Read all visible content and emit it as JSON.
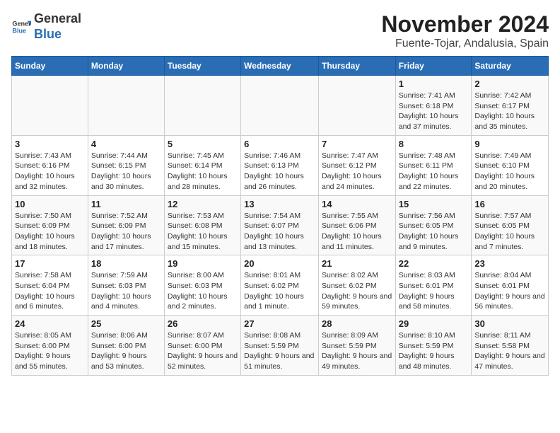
{
  "logo": {
    "general": "General",
    "blue": "Blue"
  },
  "title": "November 2024",
  "subtitle": "Fuente-Tojar, Andalusia, Spain",
  "weekdays": [
    "Sunday",
    "Monday",
    "Tuesday",
    "Wednesday",
    "Thursday",
    "Friday",
    "Saturday"
  ],
  "weeks": [
    [
      {
        "day": "",
        "details": ""
      },
      {
        "day": "",
        "details": ""
      },
      {
        "day": "",
        "details": ""
      },
      {
        "day": "",
        "details": ""
      },
      {
        "day": "",
        "details": ""
      },
      {
        "day": "1",
        "details": "Sunrise: 7:41 AM\nSunset: 6:18 PM\nDaylight: 10 hours and 37 minutes."
      },
      {
        "day": "2",
        "details": "Sunrise: 7:42 AM\nSunset: 6:17 PM\nDaylight: 10 hours and 35 minutes."
      }
    ],
    [
      {
        "day": "3",
        "details": "Sunrise: 7:43 AM\nSunset: 6:16 PM\nDaylight: 10 hours and 32 minutes."
      },
      {
        "day": "4",
        "details": "Sunrise: 7:44 AM\nSunset: 6:15 PM\nDaylight: 10 hours and 30 minutes."
      },
      {
        "day": "5",
        "details": "Sunrise: 7:45 AM\nSunset: 6:14 PM\nDaylight: 10 hours and 28 minutes."
      },
      {
        "day": "6",
        "details": "Sunrise: 7:46 AM\nSunset: 6:13 PM\nDaylight: 10 hours and 26 minutes."
      },
      {
        "day": "7",
        "details": "Sunrise: 7:47 AM\nSunset: 6:12 PM\nDaylight: 10 hours and 24 minutes."
      },
      {
        "day": "8",
        "details": "Sunrise: 7:48 AM\nSunset: 6:11 PM\nDaylight: 10 hours and 22 minutes."
      },
      {
        "day": "9",
        "details": "Sunrise: 7:49 AM\nSunset: 6:10 PM\nDaylight: 10 hours and 20 minutes."
      }
    ],
    [
      {
        "day": "10",
        "details": "Sunrise: 7:50 AM\nSunset: 6:09 PM\nDaylight: 10 hours and 18 minutes."
      },
      {
        "day": "11",
        "details": "Sunrise: 7:52 AM\nSunset: 6:09 PM\nDaylight: 10 hours and 17 minutes."
      },
      {
        "day": "12",
        "details": "Sunrise: 7:53 AM\nSunset: 6:08 PM\nDaylight: 10 hours and 15 minutes."
      },
      {
        "day": "13",
        "details": "Sunrise: 7:54 AM\nSunset: 6:07 PM\nDaylight: 10 hours and 13 minutes."
      },
      {
        "day": "14",
        "details": "Sunrise: 7:55 AM\nSunset: 6:06 PM\nDaylight: 10 hours and 11 minutes."
      },
      {
        "day": "15",
        "details": "Sunrise: 7:56 AM\nSunset: 6:05 PM\nDaylight: 10 hours and 9 minutes."
      },
      {
        "day": "16",
        "details": "Sunrise: 7:57 AM\nSunset: 6:05 PM\nDaylight: 10 hours and 7 minutes."
      }
    ],
    [
      {
        "day": "17",
        "details": "Sunrise: 7:58 AM\nSunset: 6:04 PM\nDaylight: 10 hours and 6 minutes."
      },
      {
        "day": "18",
        "details": "Sunrise: 7:59 AM\nSunset: 6:03 PM\nDaylight: 10 hours and 4 minutes."
      },
      {
        "day": "19",
        "details": "Sunrise: 8:00 AM\nSunset: 6:03 PM\nDaylight: 10 hours and 2 minutes."
      },
      {
        "day": "20",
        "details": "Sunrise: 8:01 AM\nSunset: 6:02 PM\nDaylight: 10 hours and 1 minute."
      },
      {
        "day": "21",
        "details": "Sunrise: 8:02 AM\nSunset: 6:02 PM\nDaylight: 9 hours and 59 minutes."
      },
      {
        "day": "22",
        "details": "Sunrise: 8:03 AM\nSunset: 6:01 PM\nDaylight: 9 hours and 58 minutes."
      },
      {
        "day": "23",
        "details": "Sunrise: 8:04 AM\nSunset: 6:01 PM\nDaylight: 9 hours and 56 minutes."
      }
    ],
    [
      {
        "day": "24",
        "details": "Sunrise: 8:05 AM\nSunset: 6:00 PM\nDaylight: 9 hours and 55 minutes."
      },
      {
        "day": "25",
        "details": "Sunrise: 8:06 AM\nSunset: 6:00 PM\nDaylight: 9 hours and 53 minutes."
      },
      {
        "day": "26",
        "details": "Sunrise: 8:07 AM\nSunset: 6:00 PM\nDaylight: 9 hours and 52 minutes."
      },
      {
        "day": "27",
        "details": "Sunrise: 8:08 AM\nSunset: 5:59 PM\nDaylight: 9 hours and 51 minutes."
      },
      {
        "day": "28",
        "details": "Sunrise: 8:09 AM\nSunset: 5:59 PM\nDaylight: 9 hours and 49 minutes."
      },
      {
        "day": "29",
        "details": "Sunrise: 8:10 AM\nSunset: 5:59 PM\nDaylight: 9 hours and 48 minutes."
      },
      {
        "day": "30",
        "details": "Sunrise: 8:11 AM\nSunset: 5:58 PM\nDaylight: 9 hours and 47 minutes."
      }
    ]
  ]
}
